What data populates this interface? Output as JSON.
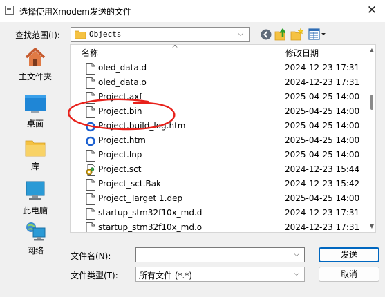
{
  "window": {
    "title": "选择使用Xmodem发送的文件",
    "close_symbol": "✕"
  },
  "look_in": {
    "label": "查找范围(I):",
    "value": "Objects",
    "arrow": "⌵"
  },
  "places": [
    {
      "label": "主文件夹",
      "icon": "home-icon"
    },
    {
      "label": "桌面",
      "icon": "desktop-icon"
    },
    {
      "label": "库",
      "icon": "library-folder-icon"
    },
    {
      "label": "此电脑",
      "icon": "computer-icon"
    },
    {
      "label": "网络",
      "icon": "network-icon"
    }
  ],
  "file_list": {
    "headers": {
      "name": "名称",
      "date": "修改日期",
      "sort_arrow": "^"
    },
    "files": [
      {
        "name": "oled_data.d",
        "date": "2024-12-23 17:31",
        "icon": "file-icon"
      },
      {
        "name": "oled_data.o",
        "date": "2024-12-23 17:31",
        "icon": "file-icon"
      },
      {
        "name": "Project.axf",
        "date": "2025-04-25 14:00",
        "icon": "file-icon"
      },
      {
        "name": "Project.bin",
        "date": "2025-04-25 14:00",
        "icon": "file-icon"
      },
      {
        "name": "Project.build_log.htm",
        "date": "2025-04-25 14:00",
        "icon": "html-file-icon"
      },
      {
        "name": "Project.htm",
        "date": "2025-04-25 14:00",
        "icon": "html-file-icon"
      },
      {
        "name": "Project.lnp",
        "date": "2025-04-25 14:00",
        "icon": "file-icon"
      },
      {
        "name": "Project.sct",
        "date": "2024-12-23 15:44",
        "icon": "script-file-icon"
      },
      {
        "name": "Project_sct.Bak",
        "date": "2024-12-23 15:42",
        "icon": "file-icon"
      },
      {
        "name": "Project_Target 1.dep",
        "date": "2025-04-25 14:00",
        "icon": "file-icon"
      },
      {
        "name": "startup_stm32f10x_md.d",
        "date": "2024-12-23 17:31",
        "icon": "file-icon"
      },
      {
        "name": "startup_stm32f10x_md.o",
        "date": "2024-12-23 17:31",
        "icon": "file-icon"
      }
    ]
  },
  "file_name": {
    "label": "文件名(N):",
    "value": "",
    "placeholder": ""
  },
  "file_type": {
    "label": "文件类型(T):",
    "value": "所有文件 (*.*)"
  },
  "buttons": {
    "send": "发送",
    "cancel": "取消"
  },
  "colors": {
    "accent": "#0067c0",
    "annotation": "#e8201a",
    "folder": "#f5c242"
  }
}
